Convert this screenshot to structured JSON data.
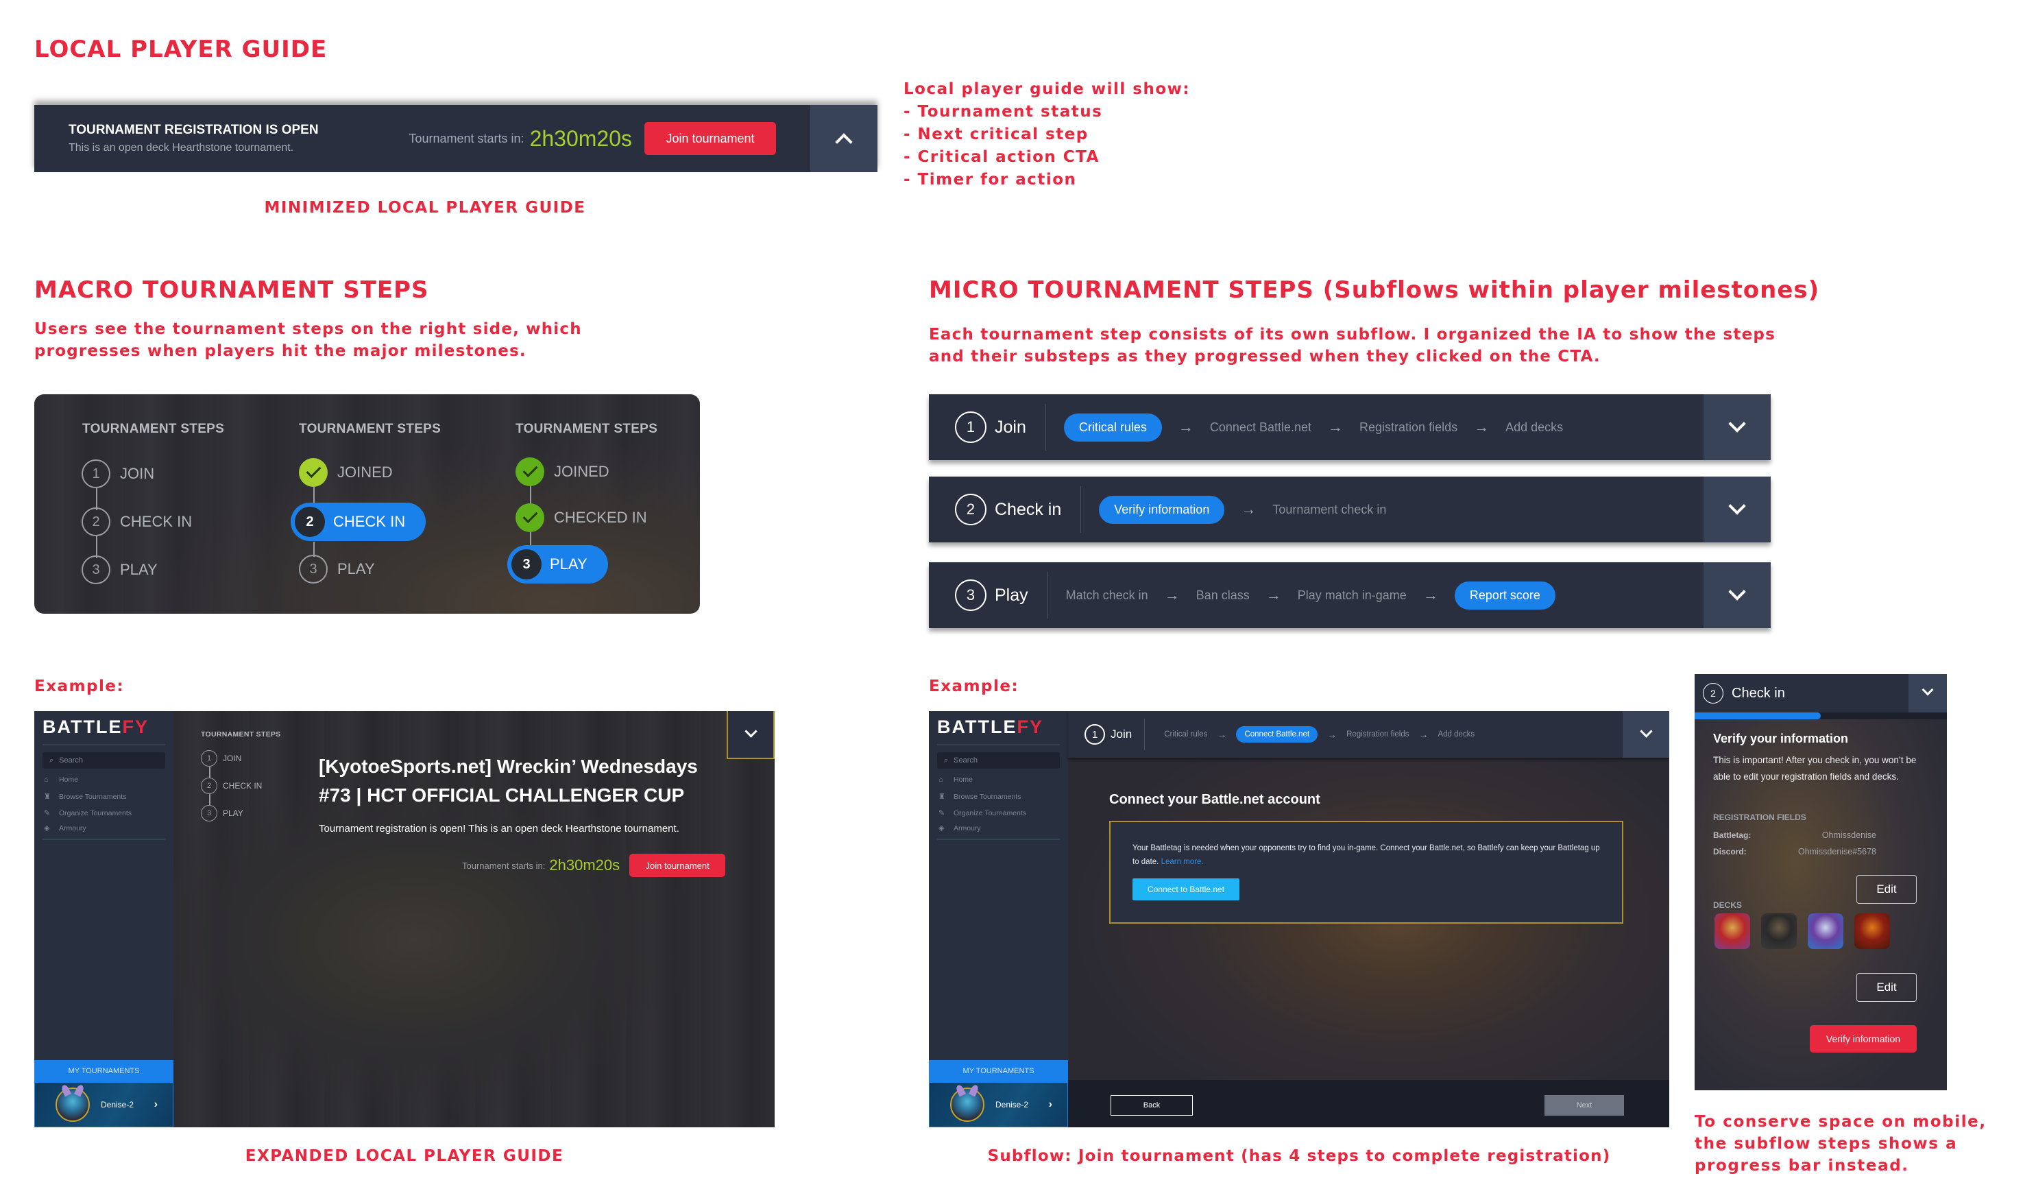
{
  "colors": {
    "accent_red": "#e8283f",
    "panel_dark": "#292f3e",
    "toggle_bg": "#394357",
    "timer_green": "#a6d02c",
    "active_blue": "#1a80ea",
    "check_light_green": "#a6d02c",
    "check_green": "#5fb019"
  },
  "local_guide": {
    "heading": "LOCAL PLAYER GUIDE",
    "minimized": {
      "status": "TOURNAMENT REGISTRATION IS OPEN",
      "subtitle": "This is an open deck Hearthstone tournament.",
      "timer_label": "Tournament starts in:",
      "timer_value": "2h30m20s",
      "cta": "Join tournament",
      "toggle_icon": "chevron-up-icon"
    },
    "caption": "MINIMIZED LOCAL PLAYER GUIDE",
    "notes": [
      "Local player guide will show:",
      "- Tournament status",
      "- Next critical step",
      "- Critical action CTA",
      "- Timer for action"
    ]
  },
  "macro": {
    "heading": "MACRO TOURNAMENT STEPS",
    "description": "Users see the tournament steps on the right side, which progresses when players hit the major milestones.",
    "columns": [
      {
        "title": "TOURNAMENT STEPS",
        "steps": [
          {
            "num": "1",
            "label": "JOIN",
            "state": "pending"
          },
          {
            "num": "2",
            "label": "CHECK IN",
            "state": "pending"
          },
          {
            "num": "3",
            "label": "PLAY",
            "state": "pending"
          }
        ]
      },
      {
        "title": "TOURNAMENT STEPS",
        "steps": [
          {
            "num": "1",
            "label": "JOINED",
            "state": "done"
          },
          {
            "num": "2",
            "label": "CHECK IN",
            "state": "active"
          },
          {
            "num": "3",
            "label": "PLAY",
            "state": "pending"
          }
        ]
      },
      {
        "title": "TOURNAMENT STEPS",
        "steps": [
          {
            "num": "1",
            "label": "JOINED",
            "state": "done"
          },
          {
            "num": "2",
            "label": "CHECKED IN",
            "state": "done"
          },
          {
            "num": "3",
            "label": "PLAY",
            "state": "active"
          }
        ]
      }
    ]
  },
  "micro": {
    "heading": "MICRO TOURNAMENT STEPS (Subflows within player milestones)",
    "description": "Each tournament step consists of its own subflow. I organized the IA to show the steps and their substeps as they progressed when they clicked on the CTA.",
    "rows": [
      {
        "num": "1",
        "name": "Join",
        "substeps": [
          {
            "label": "Critical rules",
            "active": true
          },
          {
            "label": "Connect Battle.net",
            "active": false
          },
          {
            "label": "Registration fields",
            "active": false
          },
          {
            "label": "Add decks",
            "active": false
          }
        ]
      },
      {
        "num": "2",
        "name": "Check in",
        "substeps": [
          {
            "label": "Verify information",
            "active": true
          },
          {
            "label": "Tournament check in",
            "active": false
          }
        ]
      },
      {
        "num": "3",
        "name": "Play",
        "substeps": [
          {
            "label": "Match check in",
            "active": false
          },
          {
            "label": "Ban class",
            "active": false
          },
          {
            "label": "Play match in-game",
            "active": false
          },
          {
            "label": "Report score",
            "active": true
          }
        ]
      }
    ]
  },
  "examples": {
    "label": "Example:",
    "sidebar": {
      "logo_main": "BATTLE",
      "logo_accent": "FY",
      "search_placeholder": "Search",
      "nav": [
        {
          "icon": "home-icon",
          "glyph": "⌂",
          "label": "Home"
        },
        {
          "icon": "trophy-icon",
          "glyph": "♜",
          "label": "Browse Tournaments"
        },
        {
          "icon": "wrench-icon",
          "glyph": "✎",
          "label": "Organize Tournaments"
        },
        {
          "icon": "shield-icon",
          "glyph": "◈",
          "label": "Armoury"
        }
      ],
      "my_tournaments": "MY TOURNAMENTS",
      "username": "Denise-2"
    },
    "expanded": {
      "steps_title": "TOURNAMENT STEPS",
      "steps": [
        {
          "num": "1",
          "label": "JOIN"
        },
        {
          "num": "2",
          "label": "CHECK IN"
        },
        {
          "num": "3",
          "label": "PLAY"
        }
      ],
      "title_line1": "[KyotoeSports.net] Wreckin’ Wednesdays",
      "title_line2": "#73 | HCT OFFICIAL CHALLENGER CUP",
      "subtitle": "Tournament registration is open! This is an open deck Hearthstone tournament.",
      "timer_label": "Tournament starts in:",
      "timer_value": "2h30m20s",
      "cta": "Join tournament",
      "caption": "EXPANDED LOCAL PLAYER GUIDE"
    },
    "subflow": {
      "step_num": "1",
      "step_name": "Join",
      "substeps": [
        {
          "label": "Critical rules",
          "active": false
        },
        {
          "label": "Connect Battle.net",
          "active": true
        },
        {
          "label": "Registration fields",
          "active": false
        },
        {
          "label": "Add decks",
          "active": false
        }
      ],
      "card_title": "Connect your Battle.net account",
      "card_text": "Your Battletag is needed when your opponents try to find you in-game. Connect your Battle.net, so Battlefy can keep your Battletag up to date.",
      "learn_more": "Learn more.",
      "connect_button": "Connect to Battle.net",
      "back_button": "Back",
      "next_button": "Next",
      "caption": "Subflow: Join tournament (has 4 steps to complete registration)"
    },
    "mobile": {
      "step_num": "2",
      "step_name": "Check in",
      "progress_percent": 50,
      "title": "Verify your information",
      "body": "This is important! After you check in, you won’t be able to edit your registration fields and decks.",
      "fields_heading": "REGISTRATION FIELDS",
      "fields": [
        {
          "label": "Battletag:",
          "value": "Ohmissdenise"
        },
        {
          "label": "Discord:",
          "value": "Ohmissdenise#5678"
        }
      ],
      "edit_label": "Edit",
      "decks_heading": "DECKS",
      "decks": [
        {
          "name": "deck-1",
          "colors": [
            "#b8272c",
            "#d9a84a",
            "#7a3f8f"
          ]
        },
        {
          "name": "deck-2",
          "colors": [
            "#2a2a2a",
            "#6a5a45",
            "#3b3b3b"
          ]
        },
        {
          "name": "deck-3",
          "colors": [
            "#6a3fa0",
            "#c9d6f0",
            "#2a78c8"
          ]
        },
        {
          "name": "deck-4",
          "colors": [
            "#8b1e12",
            "#e07a1a",
            "#4a1a0a"
          ]
        }
      ],
      "cta": "Verify information",
      "caption": "To conserve space on mobile, the subflow steps shows a progress bar instead."
    }
  }
}
